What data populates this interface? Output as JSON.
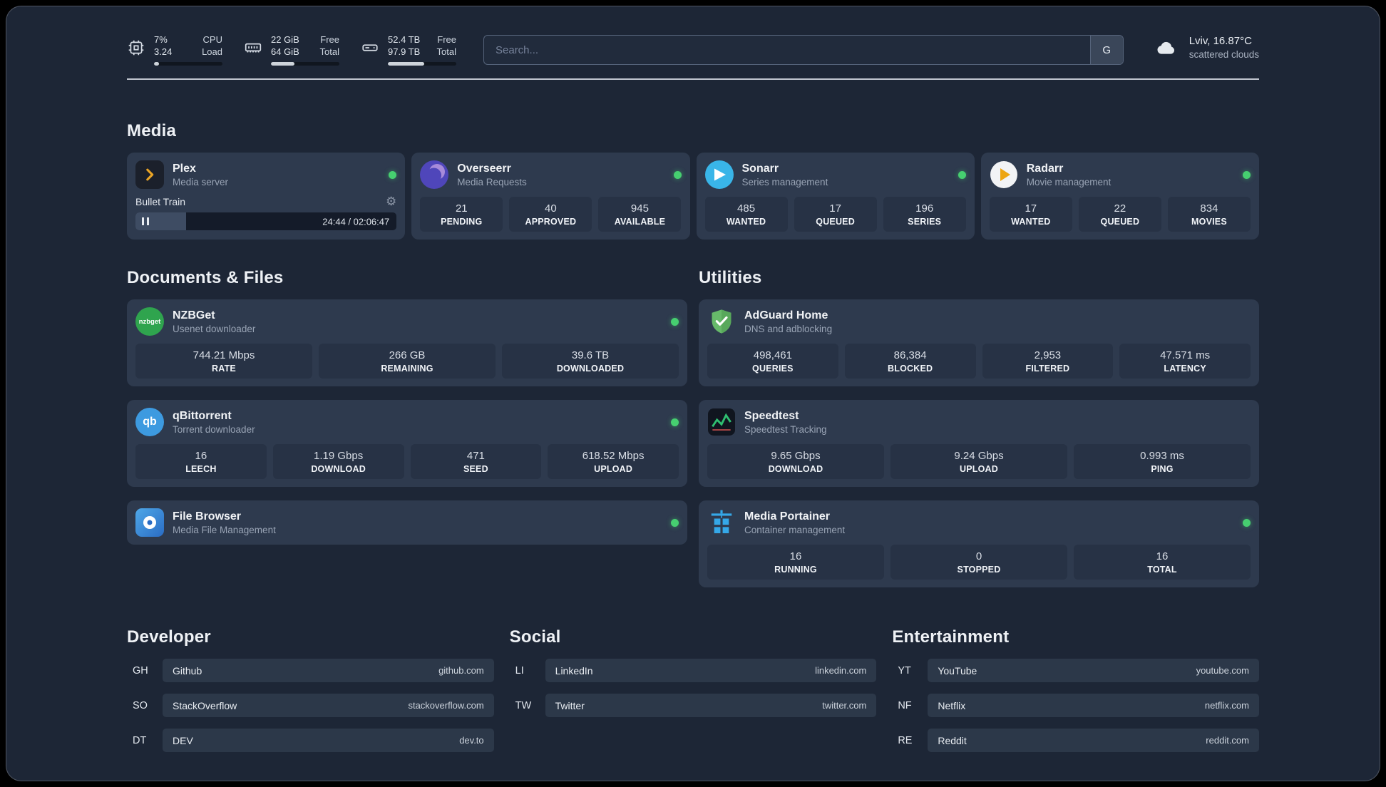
{
  "topbar": {
    "cpu": {
      "value1": "7%",
      "value2": "3.24",
      "label1": "CPU",
      "label2": "Load",
      "progress": 7
    },
    "ram": {
      "value1": "22 GiB",
      "value2": "64 GiB",
      "label1": "Free",
      "label2": "Total",
      "progress": 34
    },
    "disk": {
      "value1": "52.4 TB",
      "value2": "97.9 TB",
      "label1": "Free",
      "label2": "Total",
      "progress": 53
    },
    "search": {
      "placeholder": "Search...",
      "engine": "G"
    },
    "weather": {
      "location": "Lviv, 16.87°C",
      "condition": "scattered clouds"
    }
  },
  "sections": {
    "media": "Media",
    "documents": "Documents & Files",
    "utilities": "Utilities"
  },
  "apps": {
    "plex": {
      "name": "Plex",
      "subtitle": "Media server",
      "player": {
        "track": "Bullet Train",
        "time": "24:44 / 02:06:47",
        "progress": 19.5
      }
    },
    "overseerr": {
      "name": "Overseerr",
      "subtitle": "Media Requests",
      "stats": [
        {
          "value": "21",
          "label": "PENDING"
        },
        {
          "value": "40",
          "label": "APPROVED"
        },
        {
          "value": "945",
          "label": "AVAILABLE"
        }
      ]
    },
    "sonarr": {
      "name": "Sonarr",
      "subtitle": "Series management",
      "stats": [
        {
          "value": "485",
          "label": "WANTED"
        },
        {
          "value": "17",
          "label": "QUEUED"
        },
        {
          "value": "196",
          "label": "SERIES"
        }
      ]
    },
    "radarr": {
      "name": "Radarr",
      "subtitle": "Movie management",
      "stats": [
        {
          "value": "17",
          "label": "WANTED"
        },
        {
          "value": "22",
          "label": "QUEUED"
        },
        {
          "value": "834",
          "label": "MOVIES"
        }
      ]
    },
    "nzbget": {
      "name": "NZBGet",
      "subtitle": "Usenet downloader",
      "icon_text": "nzbget",
      "stats": [
        {
          "value": "744.21 Mbps",
          "label": "RATE"
        },
        {
          "value": "266 GB",
          "label": "REMAINING"
        },
        {
          "value": "39.6 TB",
          "label": "DOWNLOADED"
        }
      ]
    },
    "qbittorrent": {
      "name": "qBittorrent",
      "subtitle": "Torrent downloader",
      "icon_text": "qb",
      "stats": [
        {
          "value": "16",
          "label": "LEECH"
        },
        {
          "value": "1.19 Gbps",
          "label": "DOWNLOAD"
        },
        {
          "value": "471",
          "label": "SEED"
        },
        {
          "value": "618.52 Mbps",
          "label": "UPLOAD"
        }
      ]
    },
    "filebrowser": {
      "name": "File Browser",
      "subtitle": "Media File Management"
    },
    "adguard": {
      "name": "AdGuard Home",
      "subtitle": "DNS and adblocking",
      "stats": [
        {
          "value": "498,461",
          "label": "QUERIES"
        },
        {
          "value": "86,384",
          "label": "BLOCKED"
        },
        {
          "value": "2,953",
          "label": "FILTERED"
        },
        {
          "value": "47.571 ms",
          "label": "LATENCY"
        }
      ]
    },
    "speedtest": {
      "name": "Speedtest",
      "subtitle": "Speedtest Tracking",
      "stats": [
        {
          "value": "9.65 Gbps",
          "label": "DOWNLOAD"
        },
        {
          "value": "9.24 Gbps",
          "label": "UPLOAD"
        },
        {
          "value": "0.993 ms",
          "label": "PING"
        }
      ]
    },
    "portainer": {
      "name": "Media Portainer",
      "subtitle": "Container management",
      "stats": [
        {
          "value": "16",
          "label": "RUNNING"
        },
        {
          "value": "0",
          "label": "STOPPED"
        },
        {
          "value": "16",
          "label": "TOTAL"
        }
      ]
    }
  },
  "bookmarks": {
    "developer": {
      "title": "Developer",
      "items": [
        {
          "abbr": "GH",
          "name": "Github",
          "url": "github.com"
        },
        {
          "abbr": "SO",
          "name": "StackOverflow",
          "url": "stackoverflow.com"
        },
        {
          "abbr": "DT",
          "name": "DEV",
          "url": "dev.to"
        }
      ]
    },
    "social": {
      "title": "Social",
      "items": [
        {
          "abbr": "LI",
          "name": "LinkedIn",
          "url": "linkedin.com"
        },
        {
          "abbr": "TW",
          "name": "Twitter",
          "url": "twitter.com"
        }
      ]
    },
    "entertainment": {
      "title": "Entertainment",
      "items": [
        {
          "abbr": "YT",
          "name": "YouTube",
          "url": "youtube.com"
        },
        {
          "abbr": "NF",
          "name": "Netflix",
          "url": "netflix.com"
        },
        {
          "abbr": "RE",
          "name": "Reddit",
          "url": "reddit.com"
        }
      ]
    }
  }
}
